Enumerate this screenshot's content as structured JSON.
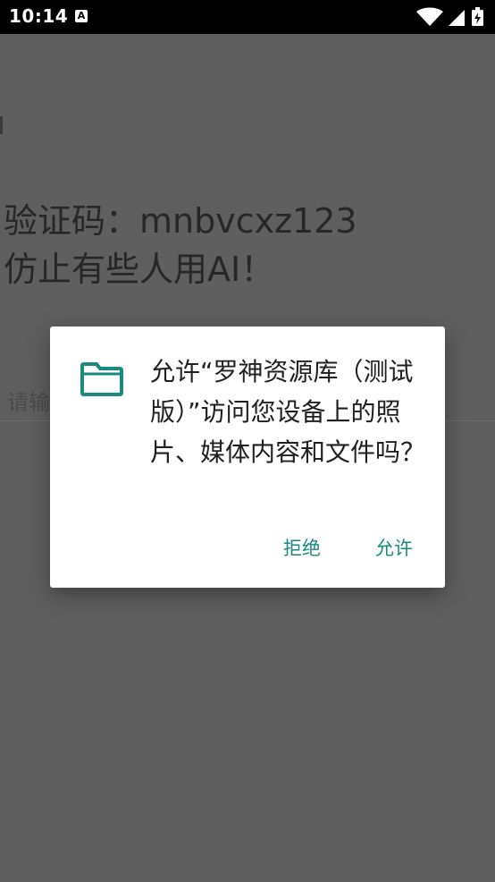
{
  "status_bar": {
    "time": "10:14",
    "notification_letter": "A"
  },
  "app": {
    "captcha_text": "验证码：mnbvcxz123",
    "warning_text": "仿止有些人用AI！",
    "input_placeholder": "请输"
  },
  "dialog": {
    "message": "允许“罗神资源库（测试版）”访问您设备上的照片、媒体内容和文件吗？",
    "deny_label": "拒绝",
    "allow_label": "允许"
  },
  "colors": {
    "accent": "#1a8a7e",
    "scrim": "#5f5f5f",
    "status_bar": "#000000"
  },
  "icons": {
    "dialog": "folder-icon",
    "status": [
      "notification-a-icon",
      "wifi-icon",
      "signal-icon",
      "battery-icon"
    ]
  }
}
